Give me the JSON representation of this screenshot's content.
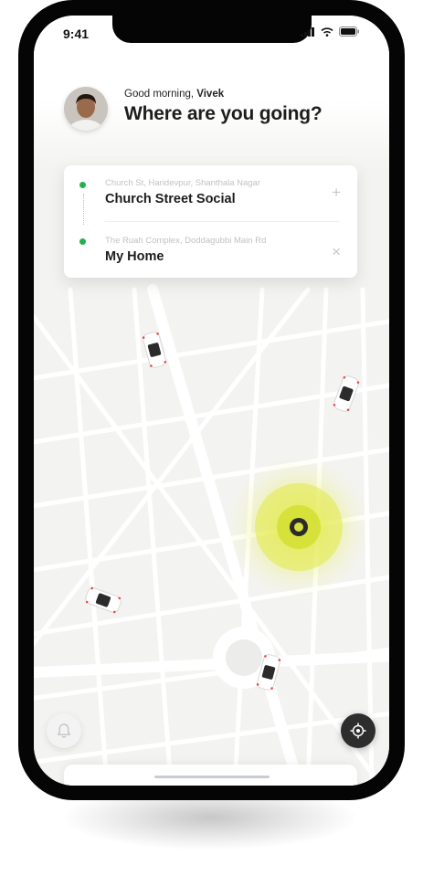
{
  "status_bar": {
    "time": "9:41"
  },
  "header": {
    "greeting_prefix": "Good morning, ",
    "user_name": "Vivek",
    "title": "Where are you going?"
  },
  "route": {
    "pickup": {
      "address": "Church St, Haridevpur, Shanthala Nagar",
      "name": "Church Street Social"
    },
    "dropoff": {
      "address": "The Ruah Complex, Doddagubbi Main Rd",
      "name": "My Home"
    }
  },
  "icons": {
    "add": "+",
    "remove": "×",
    "bell": "bell-icon",
    "locate": "crosshair-icon"
  },
  "colors": {
    "route_dot": "#22b24c",
    "location_pulse": "#d6e23a",
    "dark_button": "#2d2d2d"
  }
}
